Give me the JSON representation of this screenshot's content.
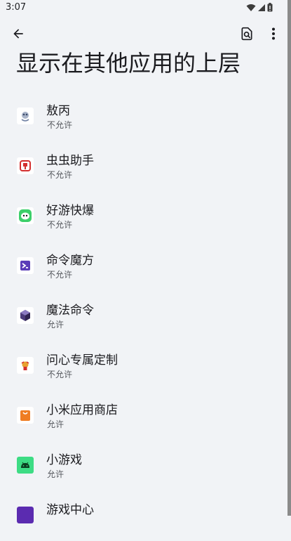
{
  "status_bar": {
    "time": "3:07",
    "icons": [
      "wifi-icon",
      "signal-icon",
      "battery-icon"
    ]
  },
  "toolbar": {
    "back_icon": "arrow-back-icon",
    "search_icon": "search-settings-icon",
    "more_icon": "more-vert-icon"
  },
  "page": {
    "title": "显示在其他应用的上层"
  },
  "apps": [
    {
      "name": "敖丙",
      "status": "不允许",
      "icon_color": "#7b8fb0"
    },
    {
      "name": "虫虫助手",
      "status": "不允许",
      "icon_color": "#d32f2f"
    },
    {
      "name": "好游快爆",
      "status": "不允许",
      "icon_color": "#3ccf6a"
    },
    {
      "name": "命令魔方",
      "status": "不允许",
      "icon_color": "#5b3db8"
    },
    {
      "name": "魔法命令",
      "status": "允许",
      "icon_color": "#4a3a7a"
    },
    {
      "name": "问心专属定制",
      "status": "不允许",
      "icon_color": "#e8a030"
    },
    {
      "name": "小米应用商店",
      "status": "允许",
      "icon_color": "#ef7d22"
    },
    {
      "name": "小游戏",
      "status": "允许",
      "icon_color": "#3ddc84"
    },
    {
      "name": "游戏中心",
      "status": "",
      "icon_color": "#5b2bb0"
    }
  ]
}
